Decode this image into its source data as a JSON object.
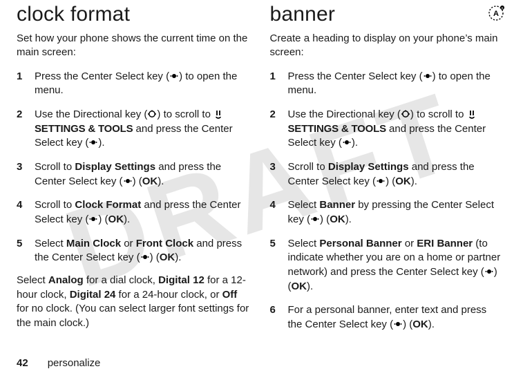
{
  "watermark": "DRAFT",
  "page": {
    "number": "42",
    "section": "personalize"
  },
  "icons": {
    "center_select": "center-select-key",
    "directional": "directional-key",
    "settings_tools": "settings-tools-icon",
    "feature_badge": "feature-badge-icon"
  },
  "left": {
    "heading": "clock format",
    "intro": "Set how your phone shows the current time on the main screen:",
    "steps": [
      {
        "n": "1",
        "pre": "Press the Center Select key (",
        "icon": "center_select",
        "post": ") to open the menu."
      },
      {
        "n": "2",
        "pre": "Use the Directional key (",
        "icon": "directional",
        "post1": ") to scroll to ",
        "bold1_icon": "settings_tools",
        "bold1": "SETTINGS & TOOLS",
        "post2": " and press the Center Select key (",
        "icon2": "center_select",
        "post3": ")."
      },
      {
        "n": "3",
        "pre": "Scroll to ",
        "bold1": "Display Settings",
        "mid": " and press the Center Select key (",
        "icon": "center_select",
        "post": ") (",
        "bold2": "OK",
        "end": ")."
      },
      {
        "n": "4",
        "pre": "Scroll to ",
        "bold1": "Clock Format",
        "mid": " and press the Center Select key (",
        "icon": "center_select",
        "post": ") (",
        "bold2": "OK",
        "end": ")."
      },
      {
        "n": "5",
        "pre": "Select ",
        "bold1": "Main Clock",
        "mid1": " or ",
        "bold2": "Front Clock",
        "mid2": " and press the Center Select key (",
        "icon": "center_select",
        "post": ") (",
        "bold3": "OK",
        "end": ")."
      }
    ],
    "after": {
      "t1": "Select ",
      "b1": "Analog",
      "t2": " for a dial clock, ",
      "b2": "Digital 12",
      "t3": " for a 12-hour clock, ",
      "b3": "Digital 24",
      "t4": " for a 24-hour clock, or ",
      "b4": "Off",
      "t5": " for no clock. (You can select larger font settings for the main clock.)"
    }
  },
  "right": {
    "heading": "banner",
    "intro": "Create a heading to display on your phone’s main screen:",
    "steps": [
      {
        "n": "1",
        "pre": "Press the Center Select key (",
        "icon": "center_select",
        "post": ") to open the menu."
      },
      {
        "n": "2",
        "pre": "Use the Directional key (",
        "icon": "directional",
        "post1": ") to scroll to ",
        "bold1_icon": "settings_tools",
        "bold1": "SETTINGS & TOOLS",
        "post2": " and press the Center Select key (",
        "icon2": "center_select",
        "post3": ")."
      },
      {
        "n": "3",
        "pre": "Scroll to ",
        "bold1": "Display Settings",
        "mid": " and press the Center Select key (",
        "icon": "center_select",
        "post": ") (",
        "bold2": "OK",
        "end": ")."
      },
      {
        "n": "4",
        "pre": "Select ",
        "bold1": "Banner",
        "mid": " by pressing the Center Select key (",
        "icon": "center_select",
        "post": ") (",
        "bold2": "OK",
        "end": ")."
      },
      {
        "n": "5",
        "pre": "Select ",
        "bold1": "Personal Banner",
        "mid1": " or ",
        "bold2": "ERI Banner",
        "mid2": " (to indicate whether you are on a home or partner network) and press the Center Select key (",
        "icon": "center_select",
        "post": ") (",
        "bold3": "OK",
        "end": ")."
      },
      {
        "n": "6",
        "pre": "For a personal banner, enter text and press the Center Select key (",
        "icon": "center_select",
        "post": ") (",
        "bold2": "OK",
        "end": ")."
      }
    ]
  }
}
